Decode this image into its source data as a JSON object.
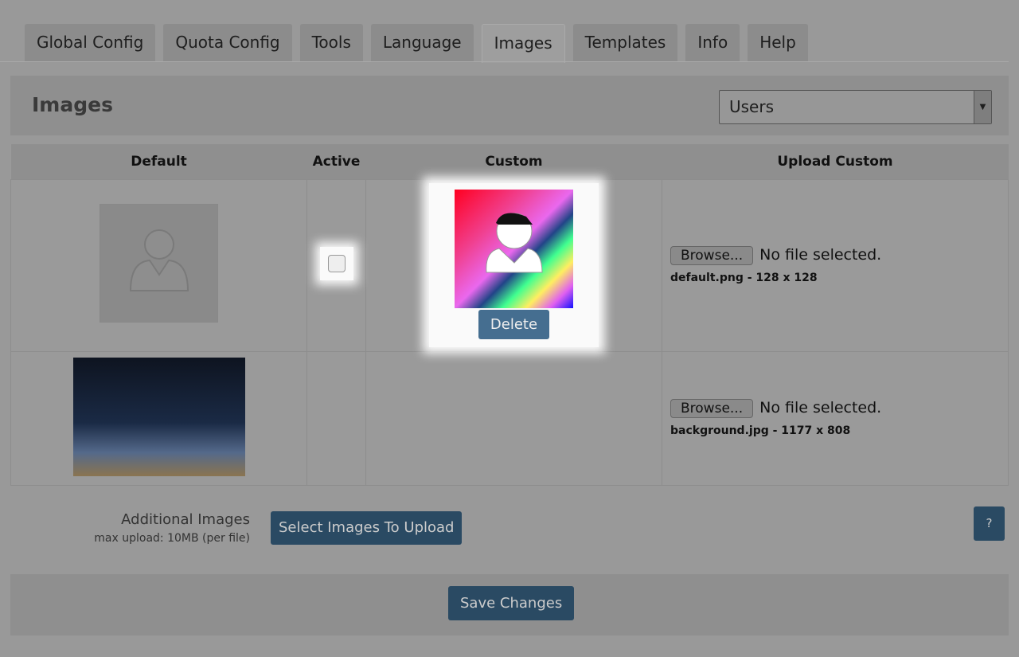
{
  "tabs": [
    "Global Config",
    "Quota Config",
    "Tools",
    "Language",
    "Images",
    "Templates",
    "Info",
    "Help"
  ],
  "active_tab": "Images",
  "header": {
    "title": "Images",
    "select_value": "Users"
  },
  "table": {
    "headers": [
      "Default",
      "Active",
      "Custom",
      "Upload Custom"
    ],
    "rows": [
      {
        "browse": "Browse...",
        "no_file": "No file selected.",
        "file": "default.png - 128 x 128",
        "delete": "Delete",
        "active": false
      },
      {
        "browse": "Browse...",
        "no_file": "No file selected.",
        "file": "background.jpg - 1177 x 808"
      }
    ]
  },
  "additional": {
    "label": "Additional Images",
    "sub": "max upload: 10MB (per file)",
    "button": "Select Images To Upload",
    "help": "?"
  },
  "footer": {
    "save": "Save Changes"
  }
}
